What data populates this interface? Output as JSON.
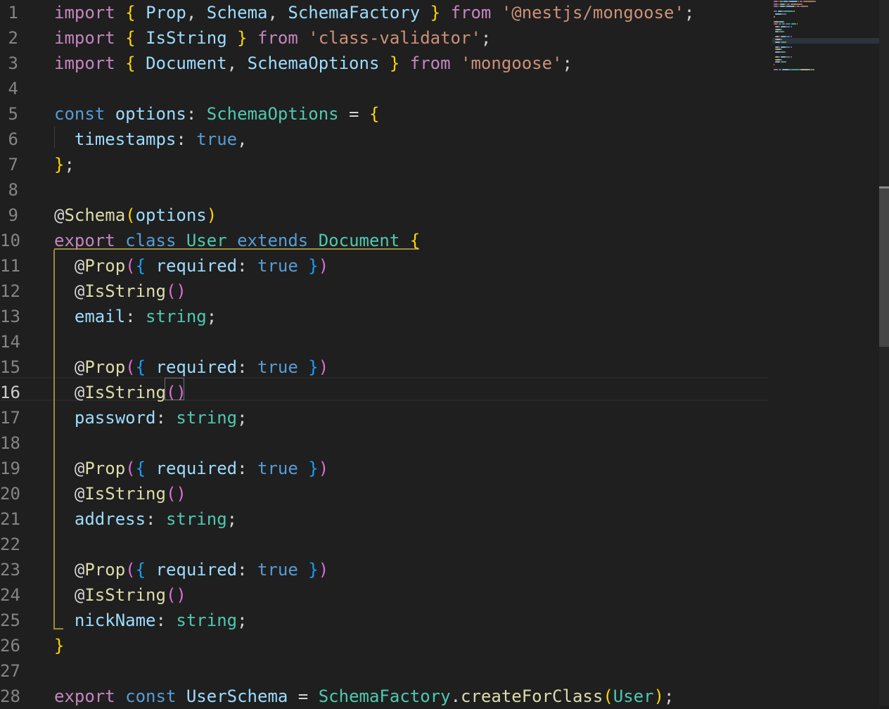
{
  "editor": {
    "theme_colors": {
      "background": "#1f1f1f",
      "keyword": "#c586c0",
      "storage": "#569cd6",
      "type": "#4ec9b0",
      "variable": "#9cdcfe",
      "function": "#dcdcaa",
      "string": "#ce9178",
      "bracket_1": "#ffd700",
      "bracket_2": "#da70d6",
      "bracket_3": "#179fff"
    },
    "active_line": 16,
    "line_numbers": [
      "1",
      "2",
      "3",
      "4",
      "5",
      "6",
      "7",
      "8",
      "9",
      "10",
      "11",
      "12",
      "13",
      "14",
      "15",
      "16",
      "17",
      "18",
      "19",
      "20",
      "21",
      "22",
      "23",
      "24",
      "25",
      "26",
      "27",
      "28"
    ],
    "lines": [
      {
        "indent": 0,
        "tokens": [
          {
            "t": "import",
            "c": "kw"
          },
          {
            "t": " ",
            "c": "pn"
          },
          {
            "t": "{",
            "c": "b1"
          },
          {
            "t": " ",
            "c": "pn"
          },
          {
            "t": "Prop",
            "c": "var"
          },
          {
            "t": ", ",
            "c": "pn"
          },
          {
            "t": "Schema",
            "c": "var"
          },
          {
            "t": ", ",
            "c": "pn"
          },
          {
            "t": "SchemaFactory",
            "c": "var"
          },
          {
            "t": " ",
            "c": "pn"
          },
          {
            "t": "}",
            "c": "b1"
          },
          {
            "t": " ",
            "c": "pn"
          },
          {
            "t": "from",
            "c": "kw"
          },
          {
            "t": " ",
            "c": "pn"
          },
          {
            "t": "'@nestjs/mongoose'",
            "c": "str"
          },
          {
            "t": ";",
            "c": "pn"
          }
        ]
      },
      {
        "indent": 0,
        "tokens": [
          {
            "t": "import",
            "c": "kw"
          },
          {
            "t": " ",
            "c": "pn"
          },
          {
            "t": "{",
            "c": "b1"
          },
          {
            "t": " ",
            "c": "pn"
          },
          {
            "t": "IsString",
            "c": "var"
          },
          {
            "t": " ",
            "c": "pn"
          },
          {
            "t": "}",
            "c": "b1"
          },
          {
            "t": " ",
            "c": "pn"
          },
          {
            "t": "from",
            "c": "kw"
          },
          {
            "t": " ",
            "c": "pn"
          },
          {
            "t": "'class-validator'",
            "c": "str"
          },
          {
            "t": ";",
            "c": "pn"
          }
        ]
      },
      {
        "indent": 0,
        "tokens": [
          {
            "t": "import",
            "c": "kw"
          },
          {
            "t": " ",
            "c": "pn"
          },
          {
            "t": "{",
            "c": "b1"
          },
          {
            "t": " ",
            "c": "pn"
          },
          {
            "t": "Document",
            "c": "var"
          },
          {
            "t": ", ",
            "c": "pn"
          },
          {
            "t": "SchemaOptions",
            "c": "var"
          },
          {
            "t": " ",
            "c": "pn"
          },
          {
            "t": "}",
            "c": "b1"
          },
          {
            "t": " ",
            "c": "pn"
          },
          {
            "t": "from",
            "c": "kw"
          },
          {
            "t": " ",
            "c": "pn"
          },
          {
            "t": "'mongoose'",
            "c": "str"
          },
          {
            "t": ";",
            "c": "pn"
          }
        ]
      },
      {
        "indent": 0,
        "tokens": []
      },
      {
        "indent": 0,
        "tokens": [
          {
            "t": "const",
            "c": "st"
          },
          {
            "t": " ",
            "c": "pn"
          },
          {
            "t": "options",
            "c": "var"
          },
          {
            "t": ": ",
            "c": "pn"
          },
          {
            "t": "SchemaOptions",
            "c": "ty"
          },
          {
            "t": " = ",
            "c": "pn"
          },
          {
            "t": "{",
            "c": "b1"
          }
        ]
      },
      {
        "indent": 2,
        "tokens": [
          {
            "t": "timestamps",
            "c": "var"
          },
          {
            "t": ": ",
            "c": "pn"
          },
          {
            "t": "true",
            "c": "st"
          },
          {
            "t": ",",
            "c": "pn"
          }
        ]
      },
      {
        "indent": 0,
        "tokens": [
          {
            "t": "}",
            "c": "b1"
          },
          {
            "t": ";",
            "c": "pn"
          }
        ]
      },
      {
        "indent": 0,
        "tokens": []
      },
      {
        "indent": 0,
        "tokens": [
          {
            "t": "@",
            "c": "pn"
          },
          {
            "t": "Schema",
            "c": "fn"
          },
          {
            "t": "(",
            "c": "b1"
          },
          {
            "t": "options",
            "c": "var"
          },
          {
            "t": ")",
            "c": "b1"
          }
        ]
      },
      {
        "indent": 0,
        "tokens": [
          {
            "t": "export",
            "c": "kw"
          },
          {
            "t": " ",
            "c": "pn"
          },
          {
            "t": "class",
            "c": "st"
          },
          {
            "t": " ",
            "c": "pn"
          },
          {
            "t": "User",
            "c": "ty"
          },
          {
            "t": " ",
            "c": "pn"
          },
          {
            "t": "extends",
            "c": "st"
          },
          {
            "t": " ",
            "c": "pn"
          },
          {
            "t": "Document",
            "c": "ty"
          },
          {
            "t": " ",
            "c": "pn"
          },
          {
            "t": "{",
            "c": "b1"
          }
        ]
      },
      {
        "indent": 2,
        "tokens": [
          {
            "t": "@",
            "c": "pn"
          },
          {
            "t": "Prop",
            "c": "fn"
          },
          {
            "t": "(",
            "c": "b2"
          },
          {
            "t": "{",
            "c": "b3"
          },
          {
            "t": " ",
            "c": "pn"
          },
          {
            "t": "required",
            "c": "var"
          },
          {
            "t": ": ",
            "c": "pn"
          },
          {
            "t": "true",
            "c": "st"
          },
          {
            "t": " ",
            "c": "pn"
          },
          {
            "t": "}",
            "c": "b3"
          },
          {
            "t": ")",
            "c": "b2"
          }
        ]
      },
      {
        "indent": 2,
        "tokens": [
          {
            "t": "@",
            "c": "pn"
          },
          {
            "t": "IsString",
            "c": "fn"
          },
          {
            "t": "()",
            "c": "b2"
          }
        ]
      },
      {
        "indent": 2,
        "tokens": [
          {
            "t": "email",
            "c": "var"
          },
          {
            "t": ": ",
            "c": "pn"
          },
          {
            "t": "string",
            "c": "ty"
          },
          {
            "t": ";",
            "c": "pn"
          }
        ]
      },
      {
        "indent": 0,
        "tokens": []
      },
      {
        "indent": 2,
        "tokens": [
          {
            "t": "@",
            "c": "pn"
          },
          {
            "t": "Prop",
            "c": "fn"
          },
          {
            "t": "(",
            "c": "b2"
          },
          {
            "t": "{",
            "c": "b3"
          },
          {
            "t": " ",
            "c": "pn"
          },
          {
            "t": "required",
            "c": "var"
          },
          {
            "t": ": ",
            "c": "pn"
          },
          {
            "t": "true",
            "c": "st"
          },
          {
            "t": " ",
            "c": "pn"
          },
          {
            "t": "}",
            "c": "b3"
          },
          {
            "t": ")",
            "c": "b2"
          }
        ]
      },
      {
        "indent": 2,
        "tokens": [
          {
            "t": "@",
            "c": "pn"
          },
          {
            "t": "IsString",
            "c": "fn"
          },
          {
            "t": "()",
            "c": "b2"
          }
        ]
      },
      {
        "indent": 2,
        "tokens": [
          {
            "t": "password",
            "c": "var"
          },
          {
            "t": ": ",
            "c": "pn"
          },
          {
            "t": "string",
            "c": "ty"
          },
          {
            "t": ";",
            "c": "pn"
          }
        ]
      },
      {
        "indent": 0,
        "tokens": []
      },
      {
        "indent": 2,
        "tokens": [
          {
            "t": "@",
            "c": "pn"
          },
          {
            "t": "Prop",
            "c": "fn"
          },
          {
            "t": "(",
            "c": "b2"
          },
          {
            "t": "{",
            "c": "b3"
          },
          {
            "t": " ",
            "c": "pn"
          },
          {
            "t": "required",
            "c": "var"
          },
          {
            "t": ": ",
            "c": "pn"
          },
          {
            "t": "true",
            "c": "st"
          },
          {
            "t": " ",
            "c": "pn"
          },
          {
            "t": "}",
            "c": "b3"
          },
          {
            "t": ")",
            "c": "b2"
          }
        ]
      },
      {
        "indent": 2,
        "tokens": [
          {
            "t": "@",
            "c": "pn"
          },
          {
            "t": "IsString",
            "c": "fn"
          },
          {
            "t": "()",
            "c": "b2"
          }
        ]
      },
      {
        "indent": 2,
        "tokens": [
          {
            "t": "address",
            "c": "var"
          },
          {
            "t": ": ",
            "c": "pn"
          },
          {
            "t": "string",
            "c": "ty"
          },
          {
            "t": ";",
            "c": "pn"
          }
        ]
      },
      {
        "indent": 0,
        "tokens": []
      },
      {
        "indent": 2,
        "tokens": [
          {
            "t": "@",
            "c": "pn"
          },
          {
            "t": "Prop",
            "c": "fn"
          },
          {
            "t": "(",
            "c": "b2"
          },
          {
            "t": "{",
            "c": "b3"
          },
          {
            "t": " ",
            "c": "pn"
          },
          {
            "t": "required",
            "c": "var"
          },
          {
            "t": ": ",
            "c": "pn"
          },
          {
            "t": "true",
            "c": "st"
          },
          {
            "t": " ",
            "c": "pn"
          },
          {
            "t": "}",
            "c": "b3"
          },
          {
            "t": ")",
            "c": "b2"
          }
        ]
      },
      {
        "indent": 2,
        "tokens": [
          {
            "t": "@",
            "c": "pn"
          },
          {
            "t": "IsString",
            "c": "fn"
          },
          {
            "t": "()",
            "c": "b2"
          }
        ]
      },
      {
        "indent": 2,
        "tokens": [
          {
            "t": "nickName",
            "c": "var"
          },
          {
            "t": ": ",
            "c": "pn"
          },
          {
            "t": "string",
            "c": "ty"
          },
          {
            "t": ";",
            "c": "pn"
          }
        ]
      },
      {
        "indent": 0,
        "tokens": [
          {
            "t": "}",
            "c": "b1"
          }
        ]
      },
      {
        "indent": 0,
        "tokens": []
      },
      {
        "indent": 0,
        "tokens": [
          {
            "t": "export",
            "c": "kw"
          },
          {
            "t": " ",
            "c": "pn"
          },
          {
            "t": "const",
            "c": "st"
          },
          {
            "t": " ",
            "c": "pn"
          },
          {
            "t": "UserSchema",
            "c": "var"
          },
          {
            "t": " = ",
            "c": "pn"
          },
          {
            "t": "SchemaFactory",
            "c": "ty"
          },
          {
            "t": ".",
            "c": "pn"
          },
          {
            "t": "createForClass",
            "c": "fn"
          },
          {
            "t": "(",
            "c": "b1"
          },
          {
            "t": "User",
            "c": "ty"
          },
          {
            "t": ")",
            "c": "b1"
          },
          {
            "t": ";",
            "c": "pn"
          }
        ]
      }
    ]
  }
}
